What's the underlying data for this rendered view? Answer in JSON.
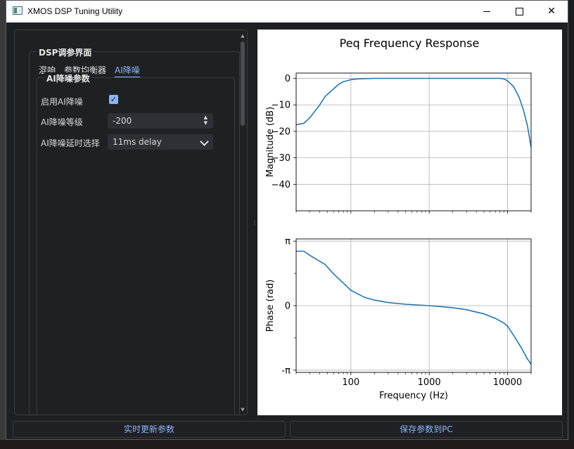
{
  "window": {
    "title": "XMOS DSP Tuning Utility"
  },
  "panel": {
    "group_title": "DSP调参界面",
    "tabs": [
      {
        "label": "混响"
      },
      {
        "label": "参数均衡器"
      },
      {
        "label": "AI降噪",
        "active": true
      }
    ],
    "subgroup_title": "AI降噪参数",
    "rows": {
      "enable_label": "启用AI降噪",
      "enable_checked": true,
      "level_label": "AI降噪等级",
      "level_value": "-200",
      "delay_label": "AI降噪延时选择",
      "delay_value": "11ms delay"
    }
  },
  "buttons": {
    "realtime": "实时更新参数",
    "save": "保存参数到PC"
  },
  "colors": {
    "accent": "#8ab4f8",
    "line": "#1f77b4",
    "panel_bg": "#1f2024"
  },
  "chart_data": [
    {
      "type": "line",
      "title": "Peq Frequency Response",
      "xlabel": "",
      "ylabel": "Magnitude (dB)",
      "xscale": "log",
      "xlim": [
        20,
        20000
      ],
      "ylim": [
        -50,
        2
      ],
      "yticks": [
        "0",
        "−10",
        "−20",
        "−30",
        "−40"
      ],
      "ytick_values": [
        0,
        -10,
        -20,
        -30,
        -40
      ],
      "grid": true,
      "series": [
        {
          "x": [
            20,
            25,
            30,
            40,
            47,
            60,
            70,
            80,
            100,
            120,
            150,
            200,
            300,
            500,
            1000,
            2000,
            4000,
            6000,
            8000,
            9000,
            10000,
            12000,
            14000,
            16000,
            18000,
            20000
          ],
          "y": [
            -17.5,
            -17.0,
            -14.8,
            -10.0,
            -6.8,
            -4.0,
            -2.2,
            -1.3,
            -0.5,
            -0.2,
            -0.1,
            0,
            0,
            0,
            0,
            0,
            0,
            0,
            0,
            -0.2,
            -0.9,
            -3.2,
            -7.0,
            -12.0,
            -18.0,
            -26.0
          ]
        }
      ]
    },
    {
      "type": "line",
      "title": "",
      "xlabel": "Frequency (Hz)",
      "ylabel": "Phase (rad)",
      "xscale": "log",
      "xlim": [
        20,
        20000
      ],
      "ylim": [
        -3.25,
        3.25
      ],
      "xticks": [
        "100",
        "1000",
        "10000"
      ],
      "xtick_values": [
        100,
        1000,
        10000
      ],
      "yticks": [
        "π",
        "0",
        "-π"
      ],
      "ytick_values": [
        3.14159,
        0,
        -3.14159
      ],
      "grid": true,
      "series": [
        {
          "x": [
            20,
            25,
            30,
            47,
            60,
            80,
            100,
            150,
            200,
            300,
            500,
            1000,
            2000,
            3000,
            5000,
            7000,
            9000,
            10000,
            12000,
            15000,
            18000,
            20000
          ],
          "y": [
            2.65,
            2.65,
            2.45,
            2.0,
            1.55,
            1.1,
            0.75,
            0.4,
            0.27,
            0.15,
            0.07,
            0,
            -0.1,
            -0.2,
            -0.4,
            -0.62,
            -0.85,
            -1.0,
            -1.45,
            -2.05,
            -2.6,
            -2.85
          ]
        }
      ]
    }
  ]
}
